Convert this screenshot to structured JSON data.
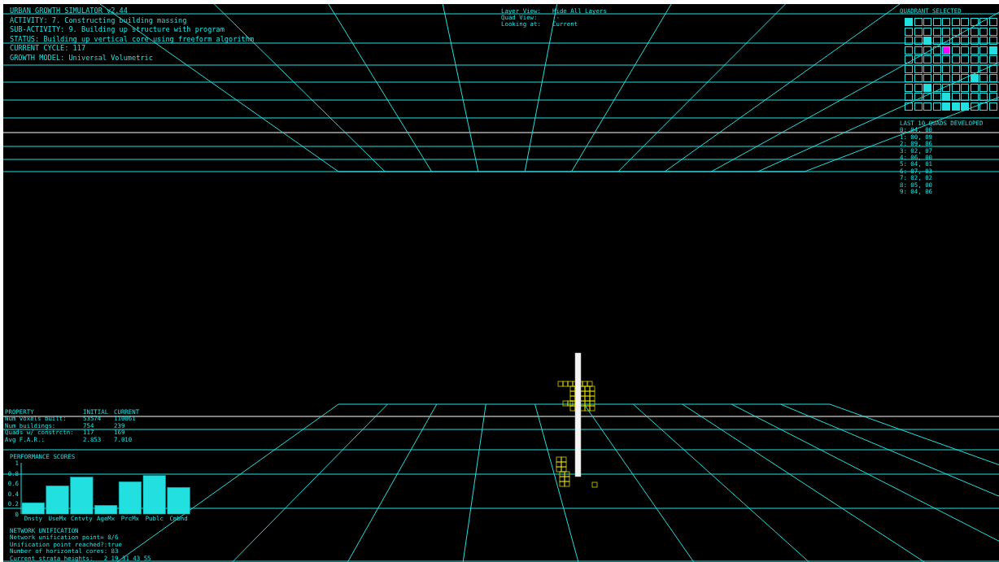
{
  "status_lines": [
    "URBAN GROWTH SIMULATOR v2.44",
    "ACTIVITY: 7. Constructing building massing",
    "SUB-ACTIVITY: 9. Building up structure with program",
    "STATUS: Building up vertical core using freeform algorithm",
    "CURRENT CYCLE: 117",
    "GROWTH MODEL: Universal Volumetric"
  ],
  "view_info": [
    {
      "label": "Layer View:",
      "value": "Hide All Layers"
    },
    {
      "label": "Quad View:",
      "value": "--"
    },
    {
      "label": "Looking at:",
      "value": "Current"
    }
  ],
  "quadrant": {
    "title": "QUADRANT SELECTED",
    "rows": [
      [
        {
          "developed": true,
          "selected": false
        },
        {
          "developed": false,
          "selected": false
        },
        {
          "developed": false,
          "selected": false
        },
        {
          "developed": false,
          "selected": false
        },
        {
          "developed": false,
          "selected": false
        },
        {
          "developed": false,
          "selected": false
        },
        {
          "developed": false,
          "selected": false
        },
        {
          "developed": false,
          "selected": false
        },
        {
          "developed": false,
          "selected": false
        },
        {
          "developed": false,
          "selected": false
        }
      ],
      [
        {
          "developed": false,
          "selected": false
        },
        {
          "developed": false,
          "selected": false
        },
        {
          "developed": false,
          "selected": false
        },
        {
          "developed": false,
          "selected": false
        },
        {
          "developed": false,
          "selected": false
        },
        {
          "developed": false,
          "selected": false
        },
        {
          "developed": false,
          "selected": false
        },
        {
          "developed": false,
          "selected": false
        },
        {
          "developed": false,
          "selected": false
        },
        {
          "developed": false,
          "selected": false
        }
      ],
      [
        {
          "developed": false,
          "selected": false
        },
        {
          "developed": false,
          "selected": false
        },
        {
          "developed": true,
          "selected": false
        },
        {
          "developed": false,
          "selected": false
        },
        {
          "developed": false,
          "selected": false
        },
        {
          "developed": false,
          "selected": false
        },
        {
          "developed": false,
          "selected": false
        },
        {
          "developed": false,
          "selected": false
        },
        {
          "developed": false,
          "selected": false
        },
        {
          "developed": false,
          "selected": false
        }
      ],
      [
        {
          "developed": false,
          "selected": false
        },
        {
          "developed": false,
          "selected": false
        },
        {
          "developed": false,
          "selected": false
        },
        {
          "developed": false,
          "selected": false
        },
        {
          "developed": false,
          "selected": true
        },
        {
          "developed": false,
          "selected": false
        },
        {
          "developed": false,
          "selected": false
        },
        {
          "developed": false,
          "selected": false
        },
        {
          "developed": false,
          "selected": false
        },
        {
          "developed": true,
          "selected": false
        }
      ],
      [
        {
          "developed": false,
          "selected": false
        },
        {
          "developed": false,
          "selected": false
        },
        {
          "developed": false,
          "selected": false
        },
        {
          "developed": false,
          "selected": false
        },
        {
          "developed": false,
          "selected": false
        },
        {
          "developed": false,
          "selected": false
        },
        {
          "developed": false,
          "selected": false
        },
        {
          "developed": false,
          "selected": false
        },
        {
          "developed": false,
          "selected": false
        },
        {
          "developed": false,
          "selected": false
        }
      ],
      [
        {
          "developed": false,
          "selected": false
        },
        {
          "developed": false,
          "selected": false
        },
        {
          "developed": false,
          "selected": false
        },
        {
          "developed": false,
          "selected": false
        },
        {
          "developed": false,
          "selected": false
        },
        {
          "developed": false,
          "selected": false
        },
        {
          "developed": false,
          "selected": false
        },
        {
          "developed": false,
          "selected": false
        },
        {
          "developed": false,
          "selected": false
        },
        {
          "developed": false,
          "selected": false
        }
      ],
      [
        {
          "developed": false,
          "selected": false
        },
        {
          "developed": false,
          "selected": false
        },
        {
          "developed": false,
          "selected": false
        },
        {
          "developed": false,
          "selected": false
        },
        {
          "developed": false,
          "selected": false
        },
        {
          "developed": false,
          "selected": false
        },
        {
          "developed": false,
          "selected": false
        },
        {
          "developed": true,
          "selected": false
        },
        {
          "developed": false,
          "selected": false
        },
        {
          "developed": false,
          "selected": false
        }
      ],
      [
        {
          "developed": false,
          "selected": false
        },
        {
          "developed": false,
          "selected": false
        },
        {
          "developed": true,
          "selected": false
        },
        {
          "developed": false,
          "selected": false
        },
        {
          "developed": false,
          "selected": false
        },
        {
          "developed": false,
          "selected": false
        },
        {
          "developed": false,
          "selected": false
        },
        {
          "developed": false,
          "selected": false
        },
        {
          "developed": false,
          "selected": false
        },
        {
          "developed": false,
          "selected": false
        }
      ],
      [
        {
          "developed": false,
          "selected": false
        },
        {
          "developed": false,
          "selected": false
        },
        {
          "developed": false,
          "selected": false
        },
        {
          "developed": false,
          "selected": false
        },
        {
          "developed": true,
          "selected": false
        },
        {
          "developed": false,
          "selected": false
        },
        {
          "developed": false,
          "selected": false
        },
        {
          "developed": false,
          "selected": false
        },
        {
          "developed": false,
          "selected": false
        },
        {
          "developed": false,
          "selected": false
        }
      ],
      [
        {
          "developed": false,
          "selected": false
        },
        {
          "developed": false,
          "selected": false
        },
        {
          "developed": false,
          "selected": false
        },
        {
          "developed": false,
          "selected": false
        },
        {
          "developed": true,
          "selected": false
        },
        {
          "developed": true,
          "selected": false
        },
        {
          "developed": true,
          "selected": false
        },
        {
          "developed": false,
          "selected": false
        },
        {
          "developed": false,
          "selected": false
        },
        {
          "developed": false,
          "selected": false
        }
      ]
    ]
  },
  "last_quads": {
    "title": "LAST 10 QUADS DEVELOPED",
    "items": [
      "0: 04, 00",
      "1: 00, 09",
      "2: 09, 06",
      "3: 02, 07",
      "4: 06, 00",
      "5: 04, 01",
      "6: 07, 03",
      "7: 02, 02",
      "8: 05, 00",
      "9: 04, 06"
    ]
  },
  "property_table": {
    "columns": [
      "PROPERTY",
      "INITIAL",
      "CURRENT"
    ],
    "rows": [
      [
        "Num voxels built:",
        "53574",
        "110061"
      ],
      [
        "Num buildings:",
        "754",
        "239"
      ],
      [
        "Quads w/ constrctn:",
        "117",
        "169"
      ],
      [
        "Avg F.A.R.:",
        "2.853",
        "7.010"
      ]
    ]
  },
  "performance": {
    "chart_data": {
      "type": "bar",
      "title": "PERFORMANCE SCORES",
      "categories": [
        "Dnsty",
        "UseMx",
        "Cntvty",
        "AgeMx",
        "PrcMx",
        "Publc",
        "Cmbnd"
      ],
      "values": [
        0.22,
        0.55,
        0.72,
        0.17,
        0.63,
        0.75,
        0.52
      ],
      "ylim": [
        0,
        1
      ],
      "yticks": [
        {
          "value": 0,
          "label": "0"
        },
        {
          "value": 0.2,
          "label": "0.2"
        },
        {
          "value": 0.4,
          "label": "0.4"
        },
        {
          "value": 0.6,
          "label": "0.6"
        },
        {
          "value": 0.8,
          "label": "0.8"
        },
        {
          "value": 1,
          "label": "1"
        }
      ]
    }
  },
  "network": {
    "title": "NETWORK UNIFICATION",
    "lines": [
      "Network unification point= 8/6",
      "Unification point reached?:true",
      "Number of horizontal cores: 83",
      "Current strata heights:   2 19 31 43 55"
    ]
  }
}
